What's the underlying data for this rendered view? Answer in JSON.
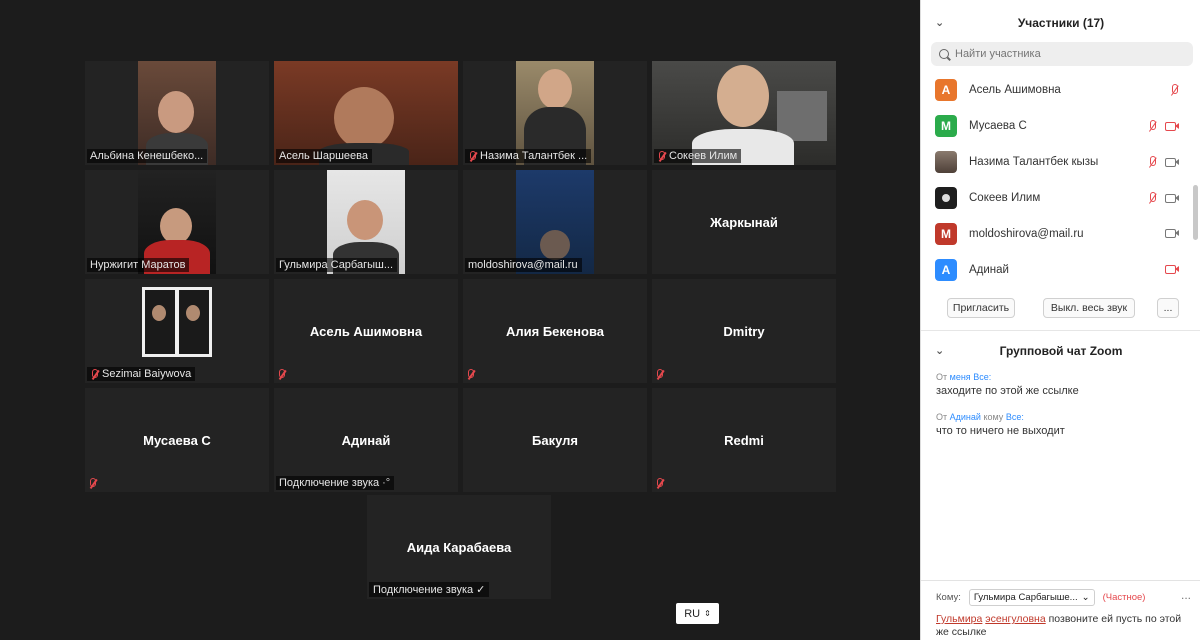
{
  "gallery": {
    "tiles": [
      {
        "name": "Альбина Кенешбеко...",
        "muted": false,
        "video": true
      },
      {
        "name": "Асель Шаршеева",
        "muted": false,
        "video": true,
        "active": true
      },
      {
        "name": "Назима Талантбек ...",
        "muted": true,
        "video": true
      },
      {
        "name": "Сокеев Илим",
        "muted": true,
        "video": true
      },
      {
        "name": "Нуржигит Маратов",
        "muted": false,
        "video": true
      },
      {
        "name": "Гульмира Сарбагыш...",
        "muted": false,
        "video": true
      },
      {
        "name": "moldoshirova@mail.ru",
        "muted": false,
        "video": true
      },
      {
        "name": "Жаркынай",
        "muted": false,
        "video": false
      },
      {
        "name": "Sezimai Baiywova",
        "muted": true,
        "video": true
      },
      {
        "name": "Асель Ашимовна",
        "muted": true,
        "video": false
      },
      {
        "name": "Алия Бекенова",
        "muted": true,
        "video": false
      },
      {
        "name": "Dmitry",
        "muted": true,
        "video": false
      },
      {
        "name": "Мусаева С",
        "muted": true,
        "video": false
      },
      {
        "name": "Адинай",
        "muted": false,
        "video": false,
        "status": "Подключение звука"
      },
      {
        "name": "Бакуля",
        "muted": false,
        "video": false
      },
      {
        "name": "Redmi",
        "muted": true,
        "video": false
      }
    ],
    "last_tile": {
      "name": "Аида Карабаева",
      "status": "Подключение звука ✓"
    },
    "language_button": "RU"
  },
  "participants_panel": {
    "title": "Участники (17)",
    "search_placeholder": "Найти участника",
    "participants": [
      {
        "initial": "А",
        "name": "Асель Ашимовна",
        "color": "#e8762c",
        "mic_off": true,
        "cam_off": false,
        "cam": false
      },
      {
        "initial": "М",
        "name": "Мусаева С",
        "color": "#2bab4b",
        "mic_off": true,
        "cam_off": true,
        "cam": true
      },
      {
        "initial": "",
        "name": "Назима Талантбек кызы",
        "color": "#6b5a4e",
        "mic_off": true,
        "cam_off": false,
        "cam": true
      },
      {
        "initial": "",
        "name": "Сокеев Илим",
        "color": "#1e1e1e",
        "mic_off": true,
        "cam_off": false,
        "cam": true
      },
      {
        "initial": "М",
        "name": "moldoshirova@mail.ru",
        "color": "#c0392b",
        "mic_off": false,
        "cam_off": false,
        "cam": true
      },
      {
        "initial": "А",
        "name": "Адинай",
        "color": "#2d8cff",
        "mic_off": false,
        "cam_off": true,
        "cam": true
      }
    ],
    "invite_label": "Пригласить",
    "mute_all_label": "Выкл. весь звук",
    "more_label": "..."
  },
  "chat_panel": {
    "title": "Групповой чат Zoom",
    "messages": [
      {
        "from_prefix": "От",
        "from": "меня",
        "to_prefix": "",
        "to": "Все:",
        "text": "заходите по этой же ссылке"
      },
      {
        "from_prefix": "От",
        "from": "Адинай",
        "to_prefix": "кому",
        "to": "Все:",
        "text": "что то ничего не выходит"
      }
    ],
    "to_label": "Кому:",
    "recipient": "Гульмира Сарбагыше...",
    "private_label": "(Частное)",
    "more_label": "...",
    "compose_parts": [
      "Гульмира",
      "эсенгуловна",
      " позвоните ей пусть по этой же ссылке"
    ]
  }
}
